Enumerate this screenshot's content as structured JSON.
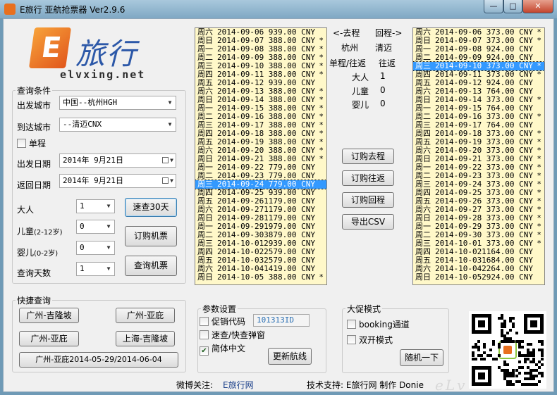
{
  "window": {
    "title": "E旅行 亚航抢票器  Ver2.9.6",
    "min_glyph": "—",
    "max_glyph": "□",
    "close_glyph": "✕"
  },
  "logo": {
    "mark": "E",
    "cn": "旅行",
    "url": "elvxing.net"
  },
  "query": {
    "group_label": "查询条件",
    "from_label": "出发城市",
    "from_value": "中国--杭州HGH",
    "to_label": "到达城市",
    "to_value": "--清迈CNX",
    "oneway_label": "单程",
    "depart_label": "出发日期",
    "depart_value": "2014年  9月21日",
    "return_label": "返回日期",
    "return_value": "2014年  9月21日",
    "adult_label": "大人",
    "adult_value": "1",
    "child_label": "儿童",
    "child_age": "(2-12岁)",
    "child_value": "0",
    "infant_label": "婴儿",
    "infant_age": "(0-2岁)",
    "infant_value": "0",
    "days_label": "查询天数",
    "days_value": "1",
    "fast30_button": "速查30天",
    "book_button": "订购机票",
    "search_button": "查询机票"
  },
  "quick": {
    "group_label": "快捷查询",
    "btn1": "广州-吉隆坡",
    "btn2": "广州-亚庇",
    "btn3": "广州-亚庇",
    "btn4": "上海-吉隆坡",
    "btn5": "广州-亚庇2014-05-29/2014-06-04"
  },
  "params": {
    "group_label": "参数设置",
    "promo_label": "促销代码",
    "promo_value": "101313ID",
    "fastpopup_label": "速查/快查弹窗",
    "simplified_label": "简体中文",
    "update_button": "更新航线"
  },
  "promo_mode": {
    "group_label": "大促模式",
    "booking_label": "booking通道",
    "dual_label": "双开模式",
    "random_button": "随机一下"
  },
  "middle": {
    "outbound_header": "<-去程",
    "return_header": "回程->",
    "from_city": "杭州",
    "to_city": "清迈",
    "trip_type_label": "单程/往返",
    "trip_type_value": "往返",
    "adult_label": "大人",
    "adult_value": "1",
    "child_label": "儿童",
    "child_value": "0",
    "infant_label": "婴儿",
    "infant_value": "0",
    "book_out_button": "订购去程",
    "book_rt_button": "订购往返",
    "book_ret_button": "订购回程",
    "export_button": "导出CSV"
  },
  "footer": {
    "weibo_label": "微博关注:",
    "weibo_link": "E旅行网",
    "support_text": "技术支持: E旅行网 制作 Donie"
  },
  "outbound": [
    {
      "day": "周六",
      "date": "2014-09-06",
      "price": "939.00 CNY",
      "star": ""
    },
    {
      "day": "周日",
      "date": "2014-09-07",
      "price": "388.00 CNY",
      "star": "*"
    },
    {
      "day": "周一",
      "date": "2014-09-08",
      "price": "388.00 CNY",
      "star": "*"
    },
    {
      "day": "周二",
      "date": "2014-09-09",
      "price": "388.00 CNY",
      "star": "*"
    },
    {
      "day": "周三",
      "date": "2014-09-10",
      "price": "388.00 CNY",
      "star": "*"
    },
    {
      "day": "周四",
      "date": "2014-09-11",
      "price": "388.00 CNY",
      "star": "*"
    },
    {
      "day": "周五",
      "date": "2014-09-12",
      "price": "939.00 CNY",
      "star": ""
    },
    {
      "day": "周六",
      "date": "2014-09-13",
      "price": "388.00 CNY",
      "star": "*"
    },
    {
      "day": "周日",
      "date": "2014-09-14",
      "price": "388.00 CNY",
      "star": "*"
    },
    {
      "day": "周一",
      "date": "2014-09-15",
      "price": "388.00 CNY",
      "star": "*"
    },
    {
      "day": "周二",
      "date": "2014-09-16",
      "price": "388.00 CNY",
      "star": "*"
    },
    {
      "day": "周三",
      "date": "2014-09-17",
      "price": "388.00 CNY",
      "star": "*"
    },
    {
      "day": "周四",
      "date": "2014-09-18",
      "price": "388.00 CNY",
      "star": "*"
    },
    {
      "day": "周五",
      "date": "2014-09-19",
      "price": "388.00 CNY",
      "star": "*"
    },
    {
      "day": "周六",
      "date": "2014-09-20",
      "price": "388.00 CNY",
      "star": "*"
    },
    {
      "day": "周日",
      "date": "2014-09-21",
      "price": "388.00 CNY",
      "star": "*"
    },
    {
      "day": "周一",
      "date": "2014-09-22",
      "price": "779.00 CNY",
      "star": ""
    },
    {
      "day": "周二",
      "date": "2014-09-23",
      "price": "779.00 CNY",
      "star": ""
    },
    {
      "day": "周三",
      "date": "2014-09-24",
      "price": "779.00 CNY",
      "star": "",
      "selected": true
    },
    {
      "day": "周四",
      "date": "2014-09-25",
      "price": "939.00 CNY",
      "star": ""
    },
    {
      "day": "周五",
      "date": "2014-09-26",
      "price": "1179.00 CNY",
      "star": ""
    },
    {
      "day": "周六",
      "date": "2014-09-27",
      "price": "1179.00 CNY",
      "star": ""
    },
    {
      "day": "周日",
      "date": "2014-09-28",
      "price": "1179.00 CNY",
      "star": ""
    },
    {
      "day": "周一",
      "date": "2014-09-29",
      "price": "1979.00 CNY",
      "star": ""
    },
    {
      "day": "周二",
      "date": "2014-09-30",
      "price": "3879.00 CNY",
      "star": ""
    },
    {
      "day": "周三",
      "date": "2014-10-01",
      "price": "2939.00 CNY",
      "star": ""
    },
    {
      "day": "周四",
      "date": "2014-10-02",
      "price": "2579.00 CNY",
      "star": ""
    },
    {
      "day": "周五",
      "date": "2014-10-03",
      "price": "2579.00 CNY",
      "star": ""
    },
    {
      "day": "周六",
      "date": "2014-10-04",
      "price": "1419.00 CNY",
      "star": ""
    },
    {
      "day": "周日",
      "date": "2014-10-05",
      "price": "388.00 CNY",
      "star": "*"
    }
  ],
  "return_list": [
    {
      "day": "周六",
      "date": "2014-09-06",
      "price": "373.00 CNY",
      "star": "*"
    },
    {
      "day": "周日",
      "date": "2014-09-07",
      "price": "373.00 CNY",
      "star": "*"
    },
    {
      "day": "周一",
      "date": "2014-09-08",
      "price": "924.00 CNY",
      "star": ""
    },
    {
      "day": "周二",
      "date": "2014-09-09",
      "price": "924.00 CNY",
      "star": ""
    },
    {
      "day": "周三",
      "date": "2014-09-10",
      "price": "373.00 CNY",
      "star": "*",
      "selected": true
    },
    {
      "day": "周四",
      "date": "2014-09-11",
      "price": "373.00 CNY",
      "star": "*"
    },
    {
      "day": "周五",
      "date": "2014-09-12",
      "price": "924.00 CNY",
      "star": ""
    },
    {
      "day": "周六",
      "date": "2014-09-13",
      "price": "764.00 CNY",
      "star": ""
    },
    {
      "day": "周日",
      "date": "2014-09-14",
      "price": "373.00 CNY",
      "star": "*"
    },
    {
      "day": "周一",
      "date": "2014-09-15",
      "price": "764.00 CNY",
      "star": ""
    },
    {
      "day": "周二",
      "date": "2014-09-16",
      "price": "373.00 CNY",
      "star": "*"
    },
    {
      "day": "周三",
      "date": "2014-09-17",
      "price": "764.00 CNY",
      "star": ""
    },
    {
      "day": "周四",
      "date": "2014-09-18",
      "price": "373.00 CNY",
      "star": "*"
    },
    {
      "day": "周五",
      "date": "2014-09-19",
      "price": "373.00 CNY",
      "star": "*"
    },
    {
      "day": "周六",
      "date": "2014-09-20",
      "price": "373.00 CNY",
      "star": "*"
    },
    {
      "day": "周日",
      "date": "2014-09-21",
      "price": "373.00 CNY",
      "star": "*"
    },
    {
      "day": "周一",
      "date": "2014-09-22",
      "price": "373.00 CNY",
      "star": "*"
    },
    {
      "day": "周二",
      "date": "2014-09-23",
      "price": "373.00 CNY",
      "star": "*"
    },
    {
      "day": "周三",
      "date": "2014-09-24",
      "price": "373.00 CNY",
      "star": "*"
    },
    {
      "day": "周四",
      "date": "2014-09-25",
      "price": "373.00 CNY",
      "star": "*"
    },
    {
      "day": "周五",
      "date": "2014-09-26",
      "price": "373.00 CNY",
      "star": "*"
    },
    {
      "day": "周六",
      "date": "2014-09-27",
      "price": "373.00 CNY",
      "star": "*"
    },
    {
      "day": "周日",
      "date": "2014-09-28",
      "price": "373.00 CNY",
      "star": "*"
    },
    {
      "day": "周一",
      "date": "2014-09-29",
      "price": "373.00 CNY",
      "star": "*"
    },
    {
      "day": "周二",
      "date": "2014-09-30",
      "price": "373.00 CNY",
      "star": "*"
    },
    {
      "day": "周三",
      "date": "2014-10-01",
      "price": "373.00 CNY",
      "star": "*"
    },
    {
      "day": "周四",
      "date": "2014-10-02",
      "price": "1164.00 CNY",
      "star": ""
    },
    {
      "day": "周五",
      "date": "2014-10-03",
      "price": "1684.00 CNY",
      "star": ""
    },
    {
      "day": "周六",
      "date": "2014-10-04",
      "price": "2264.00 CNY",
      "star": ""
    },
    {
      "day": "周日",
      "date": "2014-10-05",
      "price": "2924.00 CNY",
      "star": ""
    }
  ],
  "colors": {
    "list_bg": "#fff8c9",
    "selection": "#3399ff",
    "brand_orange": "#e8701f",
    "brand_blue": "#2c58a8"
  },
  "icons": {
    "dropdown": "chevron-down-icon",
    "calendar": "calendar-icon",
    "qr": "qr-code-icon"
  }
}
